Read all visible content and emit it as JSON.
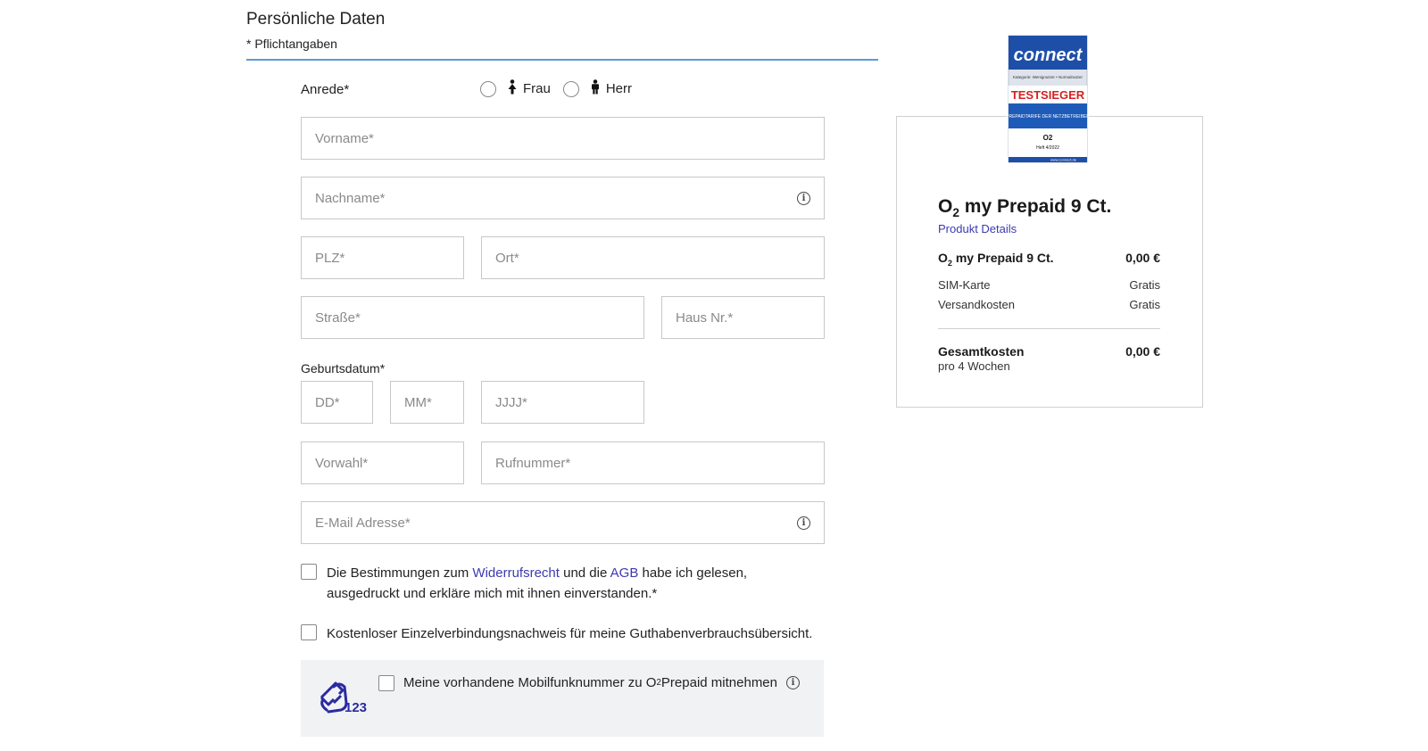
{
  "header": {
    "title": "Persönliche Daten",
    "required_note": "* Pflichtangaben"
  },
  "salutation": {
    "label": "Anrede*",
    "options": [
      {
        "label": "Frau"
      },
      {
        "label": "Herr"
      }
    ]
  },
  "fields": {
    "firstname": {
      "placeholder": "Vorname*"
    },
    "lastname": {
      "placeholder": "Nachname*"
    },
    "zip": {
      "placeholder": "PLZ*"
    },
    "city": {
      "placeholder": "Ort*"
    },
    "street": {
      "placeholder": "Straße*"
    },
    "house_no": {
      "placeholder": "Haus Nr.*"
    },
    "birthdate_label": "Geburtsdatum*",
    "day": {
      "placeholder": "DD*"
    },
    "month": {
      "placeholder": "MM*"
    },
    "year": {
      "placeholder": "JJJJ*"
    },
    "area_code": {
      "placeholder": "Vorwahl*"
    },
    "phone": {
      "placeholder": "Rufnummer*"
    },
    "email": {
      "placeholder": "E-Mail Adresse*"
    }
  },
  "consents": {
    "terms": {
      "pre": "Die Bestimmungen zum ",
      "link1": "Widerrufsrecht",
      "mid": " und die ",
      "link2": "AGB",
      "post": " habe ich gelesen,",
      "line2": "ausgedruckt und erkläre mich mit ihnen einverstanden.*"
    },
    "itemized": "Kostenloser Einzelverbindungsnachweis für meine Guthabenverbrauchsübersicht."
  },
  "porting": {
    "icon_text": "123",
    "text_pre": "Meine vorhandene Mobilfunknummer zu O",
    "text_sub": "2",
    "text_post": " Prepaid mitnehmen"
  },
  "badge": {
    "brand": "connect",
    "category": "Kategorie: Wenignutzer • Normalnutzer",
    "award": "TESTSIEGER",
    "subject": "PREPAIDTARIFE DER NETZBETREIBER",
    "operator": "O2",
    "issue": "Heft 4/2022",
    "site": "www.connect.de"
  },
  "summary": {
    "title_prefix": "O",
    "title_sub": "2",
    "title_rest": " my Prepaid 9 Ct.",
    "details_link": "Produkt Details",
    "tariff": {
      "label_prefix": "O",
      "label_sub": "2",
      "label_rest": " my Prepaid 9 Ct.",
      "price": "0,00 €"
    },
    "sim": {
      "label": "SIM-Karte",
      "price": "Gratis"
    },
    "shipping": {
      "label": "Versandkosten",
      "price": "Gratis"
    },
    "total": {
      "label": "Gesamtkosten",
      "period": "pro 4 Wochen",
      "price": "0,00 €"
    }
  },
  "colors": {
    "accent": "#3d3ab0",
    "rule": "#5b9bd5",
    "field_border": "#c8c8c8",
    "panel_bg": "#f1f2f4"
  }
}
